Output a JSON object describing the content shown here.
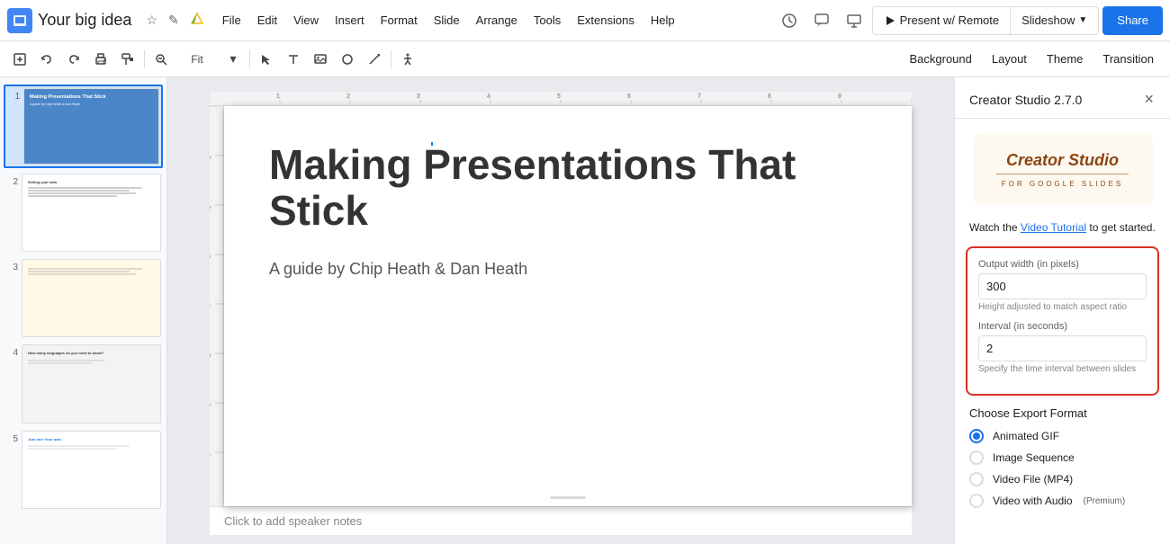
{
  "app": {
    "title": "Your big idea",
    "icon_color": "#4285f4"
  },
  "menu": {
    "items": [
      "File",
      "Edit",
      "View",
      "Insert",
      "Format",
      "Slide",
      "Arrange",
      "Tools",
      "Extensions",
      "Help"
    ]
  },
  "header": {
    "present_remote_label": "Present w/ Remote",
    "slideshow_label": "Slideshow",
    "share_label": "Share"
  },
  "toolbar": {
    "zoom_value": "Fit",
    "background_label": "Background",
    "layout_label": "Layout",
    "theme_label": "Theme",
    "transition_label": "Transition"
  },
  "slides": [
    {
      "number": "1",
      "type": "title_slide"
    },
    {
      "number": "2",
      "type": "content_slide"
    },
    {
      "number": "3",
      "type": "content_slide_2"
    },
    {
      "number": "4",
      "type": "content_slide_3"
    },
    {
      "number": "5",
      "type": "content_slide_4"
    }
  ],
  "canvas": {
    "slide_title": "Making Presentations That Stick",
    "slide_subtitle": "A guide by Chip Heath & Dan Heath",
    "notes_placeholder": "Click to add speaker notes"
  },
  "right_panel": {
    "title": "Creator Studio 2.7.0",
    "close_label": "×",
    "logo": {
      "title": "Creator Studio",
      "subtitle": "FOR GOOGLE SLIDES"
    },
    "watch_text_before": "Watch the ",
    "watch_link": "Video Tutorial",
    "watch_text_after": " to get started.",
    "form": {
      "width_label": "Output width (in pixels)",
      "width_value": "300",
      "height_label": "Height adjusted to match aspect ratio",
      "interval_label": "Interval (in seconds)",
      "interval_value": "2",
      "interval_hint": "Specify the time interval between slides"
    },
    "export": {
      "title": "Choose Export Format",
      "options": [
        {
          "label": "Animated GIF",
          "selected": true,
          "premium": false
        },
        {
          "label": "Image Sequence",
          "selected": false,
          "premium": false
        },
        {
          "label": "Video File (MP4)",
          "selected": false,
          "premium": false
        },
        {
          "label": "Video with Audio",
          "selected": false,
          "premium": true,
          "premium_label": "(Premium)"
        }
      ]
    }
  }
}
